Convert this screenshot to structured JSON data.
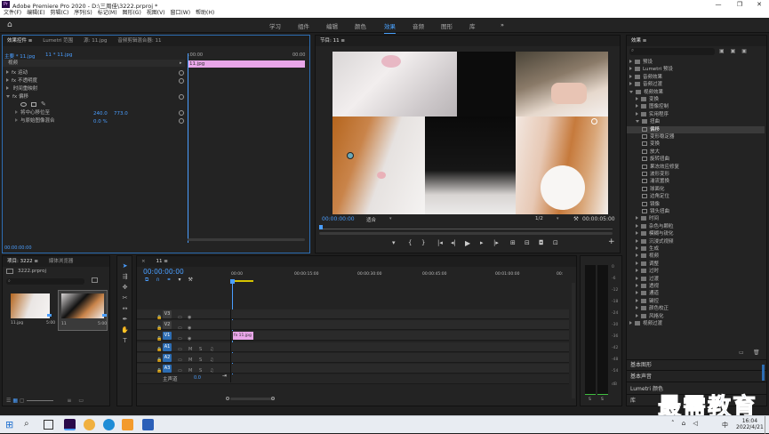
{
  "window": {
    "title": "Adobe Premiere Pro 2020 - D:\\三周佳\\3222.prproj *",
    "logo": "Pr",
    "controls": [
      "—",
      "❐",
      "✕"
    ]
  },
  "menu": [
    "文件(F)",
    "编辑(E)",
    "剪辑(C)",
    "序列(S)",
    "标记(M)",
    "图形(G)",
    "视图(V)",
    "窗口(W)",
    "帮助(H)"
  ],
  "workspaces": [
    "学习",
    "组件",
    "编辑",
    "颜色",
    "效果",
    "音频",
    "图形",
    "库"
  ],
  "active_workspace": "效果",
  "effect_controls": {
    "tabs": [
      "效果控件 ≡",
      "Lumetri 范围",
      "源: 11.jpg",
      "音频剪辑混合器: 11"
    ],
    "source_label": "主要 * 11.jpg",
    "seq_label": "11 * 11.jpg",
    "time_start": ":00:00",
    "time_end": "00:00",
    "section": "视频",
    "clip_name": "11.jpg",
    "rows": [
      {
        "label": "fx  运动"
      },
      {
        "label": "fx  不透明度"
      },
      {
        "label": "    时间重映射"
      },
      {
        "label": "fx  偏移"
      }
    ],
    "params": [
      {
        "label": "将中心移位至",
        "v1": "240.0",
        "v2": "773.0"
      },
      {
        "label": "与原始图像混合",
        "v1": "0.0 %",
        "v2": ""
      }
    ],
    "timecode": "00:00:00:00"
  },
  "program": {
    "title": "节目: 11 ≡",
    "timecode": "00:00:00:00",
    "fit": "适合",
    "quality": "1/2",
    "duration": "00:00:05:00",
    "controls": [
      "▾",
      "{",
      "}",
      "|◂",
      "◂|",
      "◂",
      "▶",
      "▸",
      "|▸",
      "▸|",
      "⊞",
      "⊟",
      "◘",
      "⊡",
      "+"
    ]
  },
  "project": {
    "tabs": [
      "项目: 3222 ≡",
      "媒体浏览器"
    ],
    "file": "3222.prproj",
    "items": [
      {
        "name": "11.jpg",
        "dur": "5:00"
      },
      {
        "name": "11",
        "dur": "5:00"
      }
    ]
  },
  "timeline": {
    "tab": "11 ≡",
    "timecode": "00:00:00:00",
    "ruler": [
      "00:00",
      "00:00:15:00",
      "00:00:30:00",
      "00:00:45:00",
      "00:01:00:00",
      "00:"
    ],
    "video_tracks": [
      "V3",
      "V2",
      "V1"
    ],
    "audio_tracks": [
      "A1",
      "A2",
      "A3"
    ],
    "master": "主声道",
    "master_val": "0.0",
    "clip": "fx 11.jpg"
  },
  "meter": {
    "ticks": [
      "0",
      "-6",
      "-12",
      "-18",
      "-24",
      "-30",
      "-36",
      "-42",
      "-48",
      "-54",
      "dB"
    ],
    "bottom": [
      "S",
      "S"
    ]
  },
  "effects": {
    "title": "效果 ≡",
    "tree": [
      {
        "label": "预设",
        "depth": 0,
        "open": false,
        "type": "folder"
      },
      {
        "label": "Lumetri 预设",
        "depth": 0,
        "open": false,
        "type": "folder"
      },
      {
        "label": "音频效果",
        "depth": 0,
        "open": false,
        "type": "folder"
      },
      {
        "label": "音频过渡",
        "depth": 0,
        "open": false,
        "type": "folder"
      },
      {
        "label": "视频效果",
        "depth": 0,
        "open": true,
        "type": "folder"
      },
      {
        "label": "变换",
        "depth": 1,
        "open": false,
        "type": "folder"
      },
      {
        "label": "图像控制",
        "depth": 1,
        "open": false,
        "type": "folder"
      },
      {
        "label": "实用程序",
        "depth": 1,
        "open": false,
        "type": "folder"
      },
      {
        "label": "扭曲",
        "depth": 1,
        "open": true,
        "type": "folder"
      },
      {
        "label": "偏移",
        "depth": 2,
        "type": "fx",
        "selected": true
      },
      {
        "label": "变形稳定器",
        "depth": 2,
        "type": "fx"
      },
      {
        "label": "变换",
        "depth": 2,
        "type": "fx"
      },
      {
        "label": "放大",
        "depth": 2,
        "type": "fx"
      },
      {
        "label": "旋转扭曲",
        "depth": 2,
        "type": "fx"
      },
      {
        "label": "果冻效应修复",
        "depth": 2,
        "type": "fx"
      },
      {
        "label": "波形变形",
        "depth": 2,
        "type": "fx"
      },
      {
        "label": "湍流置换",
        "depth": 2,
        "type": "fx"
      },
      {
        "label": "球面化",
        "depth": 2,
        "type": "fx"
      },
      {
        "label": "边角定位",
        "depth": 2,
        "type": "fx"
      },
      {
        "label": "镜像",
        "depth": 2,
        "type": "fx"
      },
      {
        "label": "镜头扭曲",
        "depth": 2,
        "type": "fx"
      },
      {
        "label": "时间",
        "depth": 1,
        "open": false,
        "type": "folder"
      },
      {
        "label": "杂色与颗粒",
        "depth": 1,
        "open": false,
        "type": "folder"
      },
      {
        "label": "模糊与锐化",
        "depth": 1,
        "open": false,
        "type": "folder"
      },
      {
        "label": "沉浸式视频",
        "depth": 1,
        "open": false,
        "type": "folder"
      },
      {
        "label": "生成",
        "depth": 1,
        "open": false,
        "type": "folder"
      },
      {
        "label": "视频",
        "depth": 1,
        "open": false,
        "type": "folder"
      },
      {
        "label": "调整",
        "depth": 1,
        "open": false,
        "type": "folder"
      },
      {
        "label": "过时",
        "depth": 1,
        "open": false,
        "type": "folder"
      },
      {
        "label": "过渡",
        "depth": 1,
        "open": false,
        "type": "folder"
      },
      {
        "label": "透视",
        "depth": 1,
        "open": false,
        "type": "folder"
      },
      {
        "label": "通道",
        "depth": 1,
        "open": false,
        "type": "folder"
      },
      {
        "label": "键控",
        "depth": 1,
        "open": false,
        "type": "folder"
      },
      {
        "label": "颜色校正",
        "depth": 1,
        "open": false,
        "type": "folder"
      },
      {
        "label": "风格化",
        "depth": 1,
        "open": false,
        "type": "folder"
      },
      {
        "label": "视频过渡",
        "depth": 0,
        "open": false,
        "type": "folder"
      }
    ],
    "panels": [
      "基本图形",
      "基本声音",
      "Lumetri 颜色",
      "库"
    ]
  },
  "taskbar": {
    "time": "16:04",
    "date": "2022/4/21",
    "lang": "中"
  },
  "watermark": "最需教育"
}
